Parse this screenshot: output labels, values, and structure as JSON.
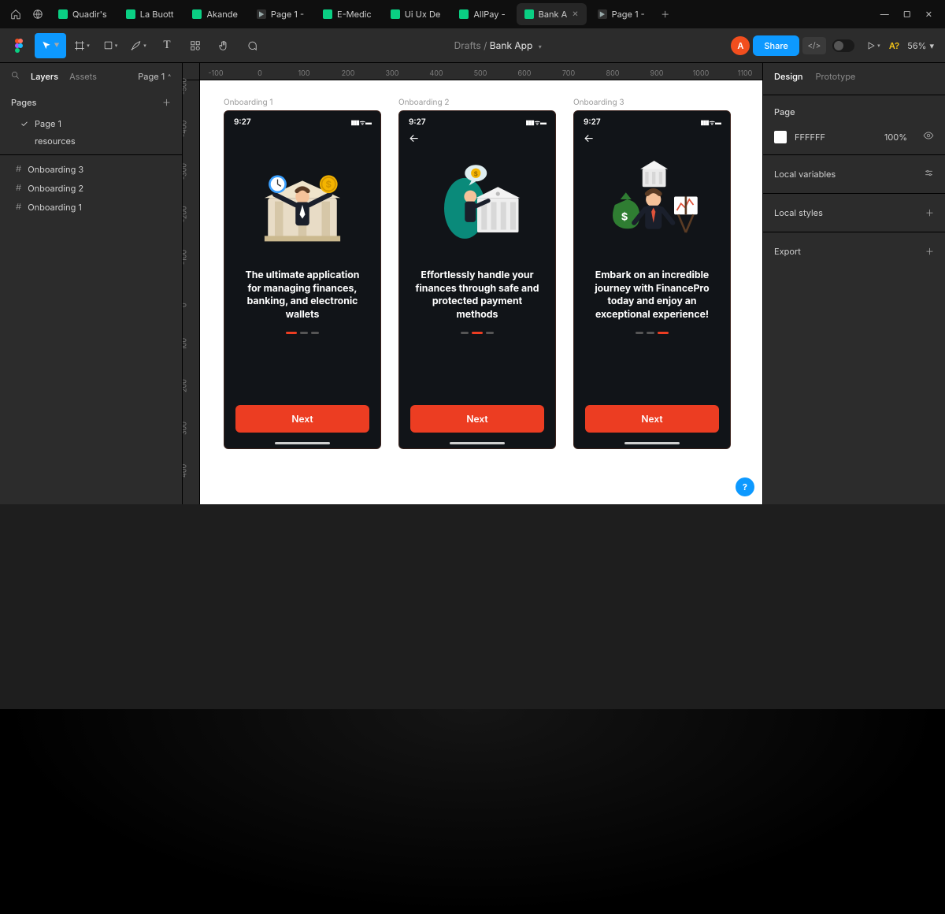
{
  "browser": {
    "tabs": [
      {
        "label": "Quadir's",
        "fav": "fig"
      },
      {
        "label": "La Buott",
        "fav": "fig"
      },
      {
        "label": "Akande",
        "fav": "fig"
      },
      {
        "label": "Page 1 -",
        "fav": "play"
      },
      {
        "label": "E-Medic",
        "fav": "fig"
      },
      {
        "label": "Ui Ux De",
        "fav": "fig"
      },
      {
        "label": "AllPay -",
        "fav": "fig"
      },
      {
        "label": "Bank A",
        "fav": "fig",
        "active": true
      },
      {
        "label": "Page 1 -",
        "fav": "play"
      }
    ]
  },
  "toolbar": {
    "breadcrumb_root": "Drafts",
    "breadcrumb_sep": "/",
    "file_name": "Bank App",
    "avatar_initial": "A",
    "share_label": "Share",
    "zoom_label": "56%",
    "a_question": "A?"
  },
  "left_panel": {
    "tab_layers": "Layers",
    "tab_assets": "Assets",
    "page_selector": "Page 1",
    "search_placeholder": "Layers",
    "pages_label": "Pages",
    "pages": [
      {
        "name": "Page 1",
        "selected": true
      },
      {
        "name": "resources",
        "selected": false
      }
    ],
    "frames": [
      {
        "name": "Onboarding 3"
      },
      {
        "name": "Onboarding 2"
      },
      {
        "name": "Onboarding 1"
      }
    ]
  },
  "right_panel": {
    "tab_design": "Design",
    "tab_prototype": "Prototype",
    "page_label": "Page",
    "page_color": "FFFFFF",
    "page_opacity": "100%",
    "local_variables": "Local variables",
    "local_styles": "Local styles",
    "export": "Export"
  },
  "ruler_h": [
    "-100",
    "0",
    "100",
    "200",
    "300",
    "400",
    "500",
    "600",
    "700",
    "800",
    "900",
    "1000",
    "1100"
  ],
  "ruler_v": [
    "-500",
    "-400",
    "-300",
    "-200",
    "-100",
    "0",
    "100",
    "200",
    "300",
    "400"
  ],
  "canvas": {
    "frames": [
      {
        "title": "Onboarding 1",
        "time": "9:27",
        "has_back": false,
        "headline": "The ultimate application for managing finances, banking, and electronic wallets",
        "active_dot": 0,
        "cta": "Next"
      },
      {
        "title": "Onboarding 2",
        "time": "9:27",
        "has_back": true,
        "headline": "Effortlessly handle your finances through safe and protected payment methods",
        "active_dot": 1,
        "cta": "Next"
      },
      {
        "title": "Onboarding 3",
        "time": "9:27",
        "has_back": true,
        "headline": "Embark on an incredible journey with FinancePro today and enjoy an exceptional experience!",
        "active_dot": 2,
        "cta": "Next"
      }
    ]
  },
  "help_label": "?"
}
